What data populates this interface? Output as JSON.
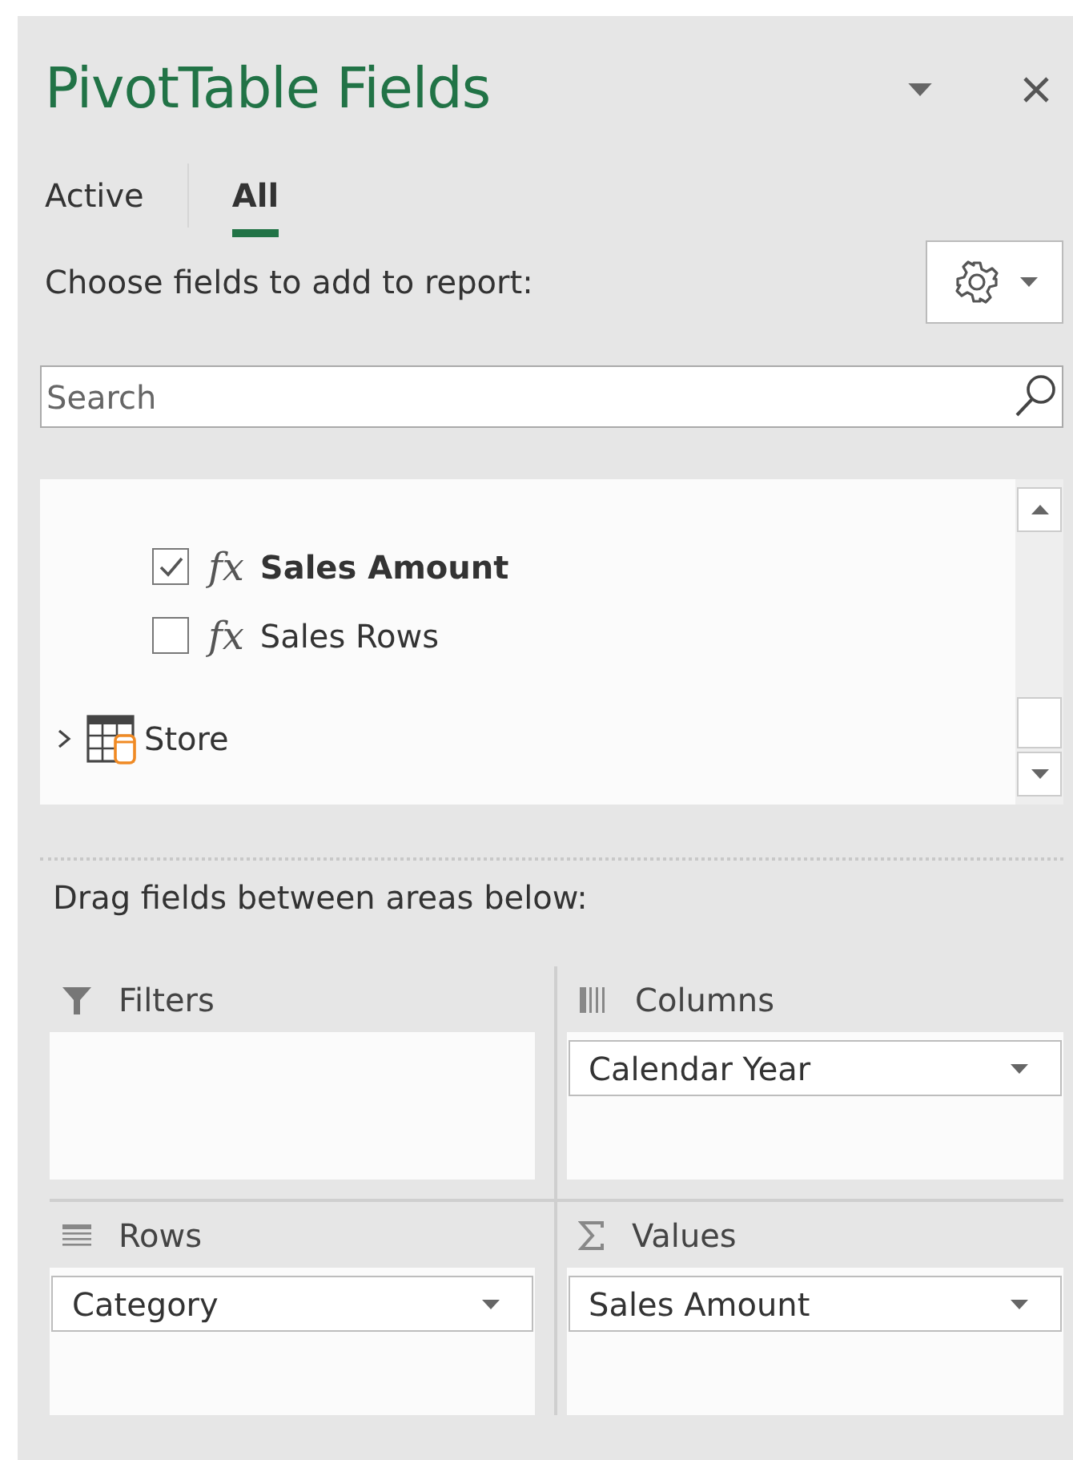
{
  "panel": {
    "title": "PivotTable Fields"
  },
  "tabs": [
    {
      "label": "Active",
      "selected": false
    },
    {
      "label": "All",
      "selected": true
    }
  ],
  "prompt": "Choose fields to add to report:",
  "search": {
    "placeholder": "Search"
  },
  "fields": [
    {
      "kind": "measure",
      "symbol": "fx",
      "label": "Sales Amount",
      "checked": true
    },
    {
      "kind": "measure",
      "symbol": "fx",
      "label": "Sales Rows",
      "checked": false
    },
    {
      "kind": "table",
      "label": "Store",
      "expanded": false
    }
  ],
  "areas_prompt": "Drag fields between areas below:",
  "areas": [
    {
      "kind": "filters",
      "label": "Filters"
    },
    {
      "kind": "columns",
      "label": "Columns",
      "items": [
        "Calendar Year"
      ]
    },
    {
      "kind": "rows",
      "label": "Rows",
      "items": [
        "Category"
      ]
    },
    {
      "kind": "values",
      "label": "Values",
      "items": [
        "Sales Amount"
      ]
    }
  ]
}
